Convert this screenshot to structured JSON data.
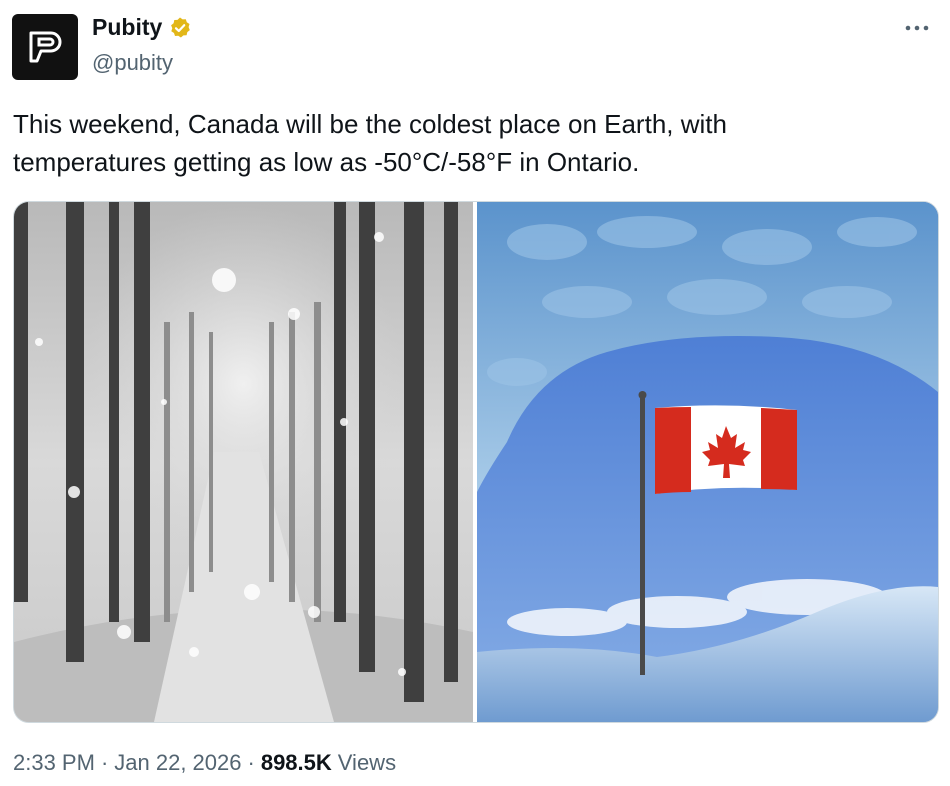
{
  "author": {
    "display_name": "Pubity",
    "handle": "@pubity",
    "avatar_icon": "pubity-logo-icon",
    "verified_badge": "verified-gold-badge-icon",
    "brand_color": "#111111",
    "badge_color": "#e2b719"
  },
  "tweet": {
    "line1": "This weekend, Canada will be the coldest place on Earth, with",
    "line2": "temperatures getting as low as -50°C/-58°F in Ontario."
  },
  "media": {
    "images": [
      {
        "name": "snowy-forest-path-photo"
      },
      {
        "name": "canada-flag-ice-cave-photo"
      }
    ]
  },
  "meta": {
    "time": "2:33 PM",
    "sep1": "·",
    "date": "Jan 22, 2026",
    "sep2": "·",
    "views_count": "898.5K",
    "views_label": "Views"
  }
}
